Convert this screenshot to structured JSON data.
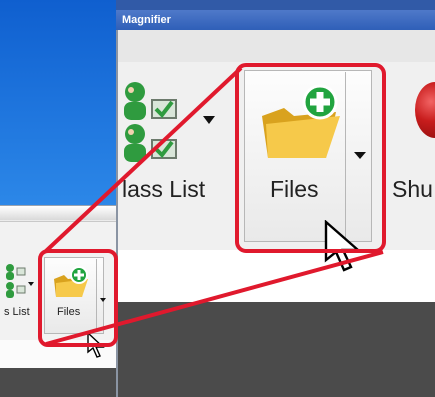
{
  "magnifier": {
    "title": "Magnifier",
    "ribbon": {
      "class_list_label": "lass List",
      "files_label": "Files",
      "shutdown_label": "Shu"
    }
  },
  "app_ribbon": {
    "class_list_label": "s List",
    "files_label": "Files"
  },
  "colors": {
    "highlight": "#e0192d",
    "desktop_blue": "#2b86e7",
    "magnifier_titlebar": "#2f5fb8"
  },
  "icons": {
    "files": "folder-add-icon",
    "class_list": "users-check-icon",
    "shutdown": "power-icon",
    "cursor": "mouse-pointer-icon"
  }
}
